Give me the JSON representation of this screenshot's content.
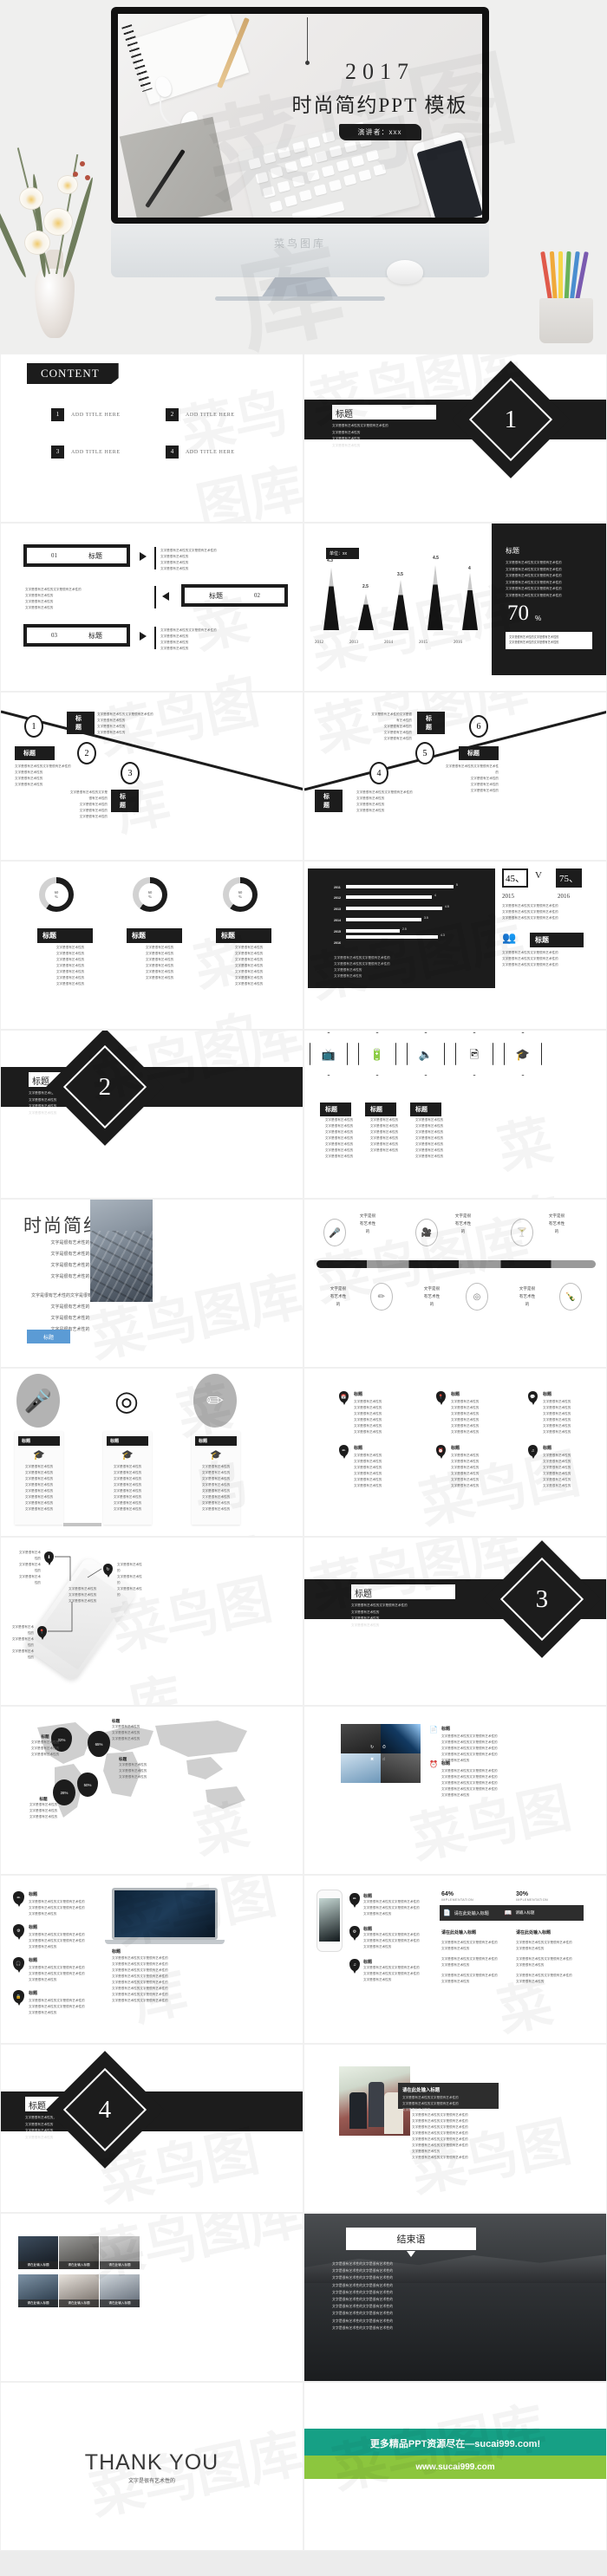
{
  "cover": {
    "year": "2017",
    "title": "时尚简约PPT 模板",
    "presenter": "演讲者：xxx",
    "brand": "菜鸟图库"
  },
  "watermark": "菜鸟图库",
  "common": {
    "heading": "标题",
    "body_line_long": "文字是很有艺术性的文字是很有艺术性的",
    "body_line": "文字是很有艺术性的",
    "input_title": "请在此处输入标题",
    "input_title_short": "请在此输入标题"
  },
  "slides": {
    "content": {
      "header": "CONTENT",
      "items": [
        {
          "num": "1",
          "label": "ADD TITLE HERE"
        },
        {
          "num": "2",
          "label": "ADD TITLE HERE"
        },
        {
          "num": "3",
          "label": "ADD TITLE HERE"
        },
        {
          "num": "4",
          "label": "ADD TITLE HERE"
        }
      ]
    },
    "sections": [
      {
        "num": "1",
        "title": "标题"
      },
      {
        "num": "2",
        "title": "标题"
      },
      {
        "num": "3",
        "title": "标题"
      },
      {
        "num": "4",
        "title": "标题"
      }
    ],
    "zigzag": {
      "rows": [
        {
          "num": "01",
          "title": "标题"
        },
        {
          "num": "02",
          "title": "标题"
        },
        {
          "num": "03",
          "title": "标题"
        }
      ]
    },
    "cone_chart_slide": {
      "unit": "单位：xx",
      "side_title": "标题",
      "big_number": "70",
      "big_unit": "%"
    },
    "timeline": {
      "steps": [
        "1",
        "2",
        "3",
        "4",
        "5",
        "6"
      ],
      "label": "标题"
    },
    "donuts": {
      "items": [
        {
          "value": "60",
          "unit": "%",
          "title": "标题"
        },
        {
          "value": "60",
          "unit": "%",
          "title": "标题"
        },
        {
          "value": "60",
          "unit": "%",
          "title": "标题"
        }
      ]
    },
    "versus": {
      "left_value": "45、",
      "vs": "V",
      "right_value": "75、",
      "left_year": "2015",
      "right_year": "2016",
      "people_title": "标题"
    },
    "hexagons": {
      "icons": [
        "tv-icon",
        "battery-icon",
        "speaker-icon",
        "image-icon",
        "jar-icon"
      ],
      "titles": [
        "标题",
        "标题",
        "标题"
      ]
    },
    "feature_photo": {
      "title": "时尚简约",
      "button": "标题"
    },
    "icon_timeline": {
      "labels": [
        "文字是很\n有艺术性\n的",
        "文字是很\n有艺术性\n的",
        "文字是很\n有艺术性\n的",
        "文字是很\n有艺术性\n的",
        "文字是很\n有艺术性\n的",
        "文字是很\n有艺术性\n的"
      ]
    },
    "circles_banner": {
      "titles": [
        "标题",
        "标题",
        "标题"
      ]
    },
    "pin_list": {
      "titles": [
        "标题",
        "标题",
        "标题",
        "标题",
        "标题",
        "标题"
      ]
    },
    "phone_callout": {
      "titles": [
        "标题",
        "标题",
        "标题"
      ]
    },
    "world_map": {
      "bubbles": [
        "22%",
        "65%",
        "28%",
        "50%"
      ],
      "labels": [
        "标题",
        "标题",
        "标题",
        "标题"
      ]
    },
    "photo_grid_4": {
      "titles": [
        "标题",
        "标题"
      ]
    },
    "laptop": {
      "titles": [
        "标题",
        "标题",
        "标题",
        "标题"
      ],
      "caption_title": "标题"
    },
    "phone_stats": {
      "stats": [
        {
          "value": "64%",
          "label": "IMPLEMENTATION"
        },
        {
          "value": "30%",
          "label": "IMPLEMENTATION"
        }
      ],
      "buttons": [
        "请在此处输入标题",
        "请输入标题"
      ],
      "columns": [
        "请在此处输入标题",
        "请在此处输入标题"
      ],
      "titles": [
        "标题",
        "标题",
        "标题"
      ]
    },
    "meeting_photo": {
      "title": "请在此处输入标题"
    },
    "photo_grid_6": {
      "captions": [
        "请在此输入标题",
        "请在此输入标题",
        "请在此输入标题",
        "请在此输入标题",
        "请在此输入标题",
        "请在此输入标题"
      ]
    },
    "closing": {
      "title": "结束语"
    },
    "thanks": {
      "title": "THANK YOU",
      "subtitle": "文字是很有艺术性的"
    },
    "promo": {
      "line1": "更多精品PPT资源尽在—sucai999.com!",
      "line2": "www.sucai999.com"
    }
  },
  "chart_data": [
    {
      "type": "bar",
      "title": "单位：xx",
      "categories": [
        "2012",
        "2013",
        "2014",
        "2015",
        "2016"
      ],
      "values": [
        4.3,
        2.5,
        3.5,
        4.5,
        4
      ],
      "xlabel": "",
      "ylabel": "",
      "ylim": [
        0,
        5
      ]
    },
    {
      "type": "bar",
      "title": "",
      "orientation": "horizontal",
      "categories": [
        "2011",
        "2012",
        "2013",
        "2014",
        "2015",
        "2016"
      ],
      "values": [
        5,
        4,
        4.5,
        3.5,
        2.5,
        4.3
      ],
      "xlabel": "",
      "ylabel": "",
      "ylim": [
        0,
        5
      ]
    },
    {
      "type": "pie",
      "title": "",
      "labels": [
        "标题",
        "标题",
        "标题"
      ],
      "values": [
        60,
        60,
        60
      ],
      "unit": "%"
    },
    {
      "type": "bar",
      "title": "",
      "categories": [
        "2015",
        "2016"
      ],
      "values": [
        45,
        75
      ],
      "ylim": [
        0,
        100
      ]
    },
    {
      "type": "heatmap",
      "title": "world-map-bubbles",
      "labels": [
        "22%",
        "65%",
        "28%",
        "50%"
      ],
      "values": [
        22,
        65,
        28,
        50
      ]
    },
    {
      "type": "bar",
      "title": "IMPLEMENTATION",
      "categories": [
        "IMPLEMENTATION",
        "IMPLEMENTATION"
      ],
      "values": [
        64,
        30
      ],
      "ylim": [
        0,
        100
      ]
    }
  ]
}
